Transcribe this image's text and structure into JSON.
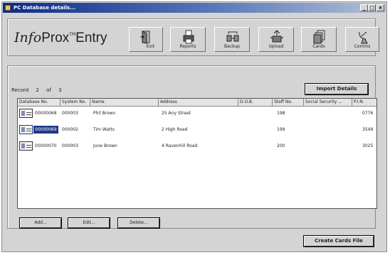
{
  "window": {
    "title": "PC Database details...",
    "min_label": "_",
    "max_label": "□",
    "close_label": "×"
  },
  "logo": {
    "part1": "Info",
    "part2": "Prox",
    "tm": "TM",
    "part3": "Entry"
  },
  "toolbar": {
    "exit": "Exit",
    "reports": "Reports",
    "backup": "Backup",
    "upload": "Upload",
    "cards": "Cards",
    "comms": "Comms"
  },
  "record": {
    "label": "Record",
    "current": "2",
    "of": "of",
    "total": "3"
  },
  "import_button": "Import Details",
  "table": {
    "columns": [
      "Database No.",
      "System No.",
      "Name",
      "Address",
      "D.O.B.",
      "Staff No.",
      "Social Security ...",
      "P.I.N."
    ],
    "rows": [
      [
        "00000068",
        "000003",
        "Phil Brown",
        "25 Any Street",
        "",
        "198",
        "",
        "0776"
      ],
      [
        "00000069",
        "000002",
        "Tim Watts",
        "2 High Road",
        "",
        "199",
        "",
        "3549"
      ],
      [
        "00000070",
        "000003",
        "June Brown",
        "4 Ravenhill Road",
        "",
        "200",
        "",
        "3025"
      ]
    ],
    "selected_row": 1
  },
  "buttons": {
    "add": "Add...",
    "edit": "Edit...",
    "delete": "Delete..."
  },
  "create_button": "Create Cards File"
}
